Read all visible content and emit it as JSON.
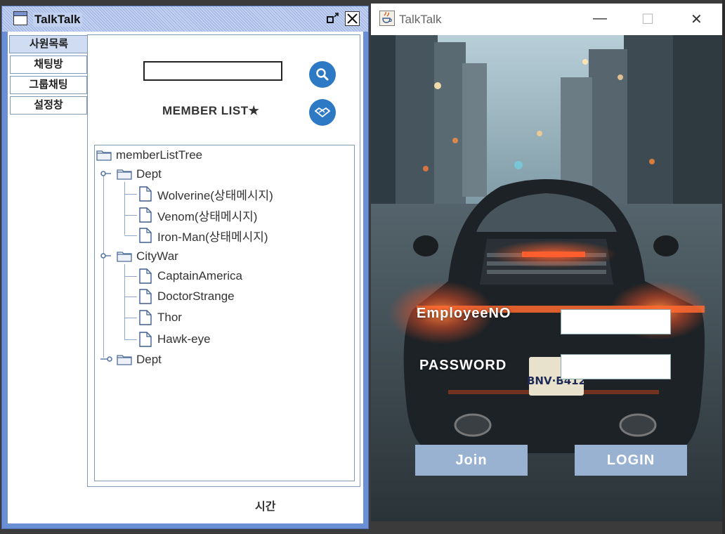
{
  "left_window": {
    "title": "TalkTalk",
    "restore_glyph": "⧉",
    "close_glyph": "✕",
    "tabs": [
      {
        "label": "사원목록"
      },
      {
        "label": "채팅방"
      },
      {
        "label": "그룹채팅"
      },
      {
        "label": "설정창"
      }
    ],
    "search": {
      "value": "",
      "placeholder": ""
    },
    "member_list_label": "MEMBER LIST★",
    "tree": {
      "root": "memberListTree",
      "groups": [
        {
          "name": "Dept",
          "expanded": true,
          "members": [
            "Wolverine(상태메시지)",
            "Venom(상태메시지)",
            "Iron-Man(상태메시지)"
          ]
        },
        {
          "name": "CityWar",
          "expanded": true,
          "members": [
            "CaptainAmerica",
            "DoctorStrange",
            "Thor",
            "Hawk-eye"
          ]
        },
        {
          "name": "Dept",
          "expanded": false,
          "members": []
        }
      ]
    },
    "time_label": "시간"
  },
  "right_window": {
    "title": "TalkTalk",
    "controls": {
      "minimize": "—",
      "maximize": "☐",
      "close": "✕"
    },
    "employee_no_label": "EmployeeNO",
    "employee_no_value": "",
    "password_label": "PASSWORD",
    "password_value": "",
    "join_label": "Join",
    "login_label": "LOGIN",
    "plate_text": "BNV·B412"
  },
  "colors": {
    "left_frame": "#6b8fd4",
    "tab_selected": "#cfdcf2",
    "round_button": "#2d79c4",
    "login_button": "#9ab2d2"
  }
}
